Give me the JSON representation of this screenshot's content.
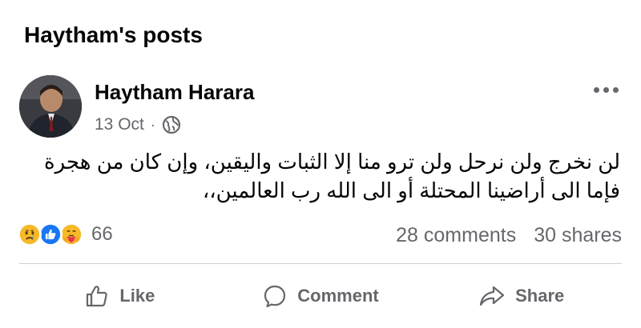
{
  "section": {
    "title": "Haytham's posts"
  },
  "post": {
    "author": "Haytham Harara",
    "date": "13 Oct",
    "separator": "·",
    "privacy_icon": "globe-icon",
    "more_icon": "more-options-icon",
    "body_line1": "لن نخرج ولن نرحل ولن ترو منا إلا الثبات واليقين، وإن كان من هجرة",
    "body_line2": "فإما الى أراضينا المحتلة أو الى الله رب العالمين،،",
    "reactions": {
      "icons": [
        "sad-reaction-icon",
        "like-reaction-icon",
        "care-reaction-icon"
      ],
      "count": "66"
    },
    "comments": "28 comments",
    "shares": "30 shares"
  },
  "actions": {
    "like": {
      "label": "Like",
      "icon": "like-icon"
    },
    "comment": {
      "label": "Comment",
      "icon": "comment-icon"
    },
    "share": {
      "label": "Share",
      "icon": "share-icon"
    }
  },
  "colors": {
    "text_primary": "#050505",
    "text_secondary": "#65676b",
    "like_blue": "#1877f2",
    "divider": "#ced0d4"
  }
}
